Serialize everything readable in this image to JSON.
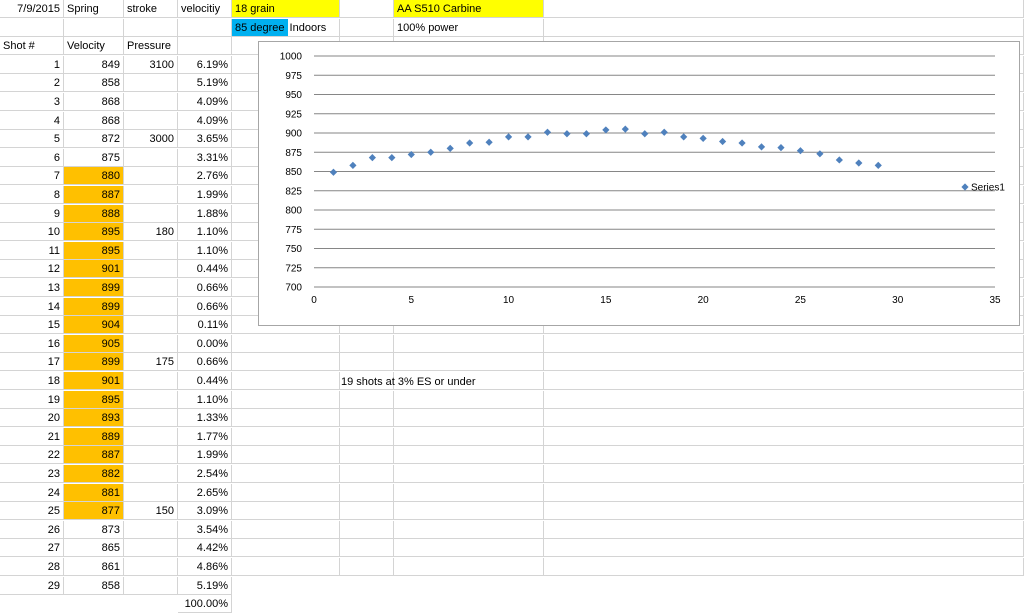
{
  "header": {
    "date": "7/9/2015",
    "spring": "Spring",
    "stroke": "stroke",
    "velocity": "velocitiy",
    "grain": "18 grain",
    "rifle": "AA S510 Carbine",
    "temperature": "85 degree",
    "location": "Indoors",
    "power": "100% power"
  },
  "columns": {
    "shot": "Shot #",
    "velocity": "Velocity",
    "pressure": "Pressure"
  },
  "rows": [
    {
      "shot": "1",
      "velocity": "849",
      "pressure": "3100",
      "pct": "6.19%"
    },
    {
      "shot": "2",
      "velocity": "858",
      "pressure": "",
      "pct": "5.19%"
    },
    {
      "shot": "3",
      "velocity": "868",
      "pressure": "",
      "pct": "4.09%"
    },
    {
      "shot": "4",
      "velocity": "868",
      "pressure": "",
      "pct": "4.09%"
    },
    {
      "shot": "5",
      "velocity": "872",
      "pressure": "3000",
      "pct": "3.65%"
    },
    {
      "shot": "6",
      "velocity": "875",
      "pressure": "",
      "pct": "3.31%"
    },
    {
      "shot": "7",
      "velocity": "880",
      "pressure": "",
      "pct": "2.76%"
    },
    {
      "shot": "8",
      "velocity": "887",
      "pressure": "",
      "pct": "1.99%"
    },
    {
      "shot": "9",
      "velocity": "888",
      "pressure": "",
      "pct": "1.88%"
    },
    {
      "shot": "10",
      "velocity": "895",
      "pressure": "180",
      "pct": "1.10%"
    },
    {
      "shot": "11",
      "velocity": "895",
      "pressure": "",
      "pct": "1.10%"
    },
    {
      "shot": "12",
      "velocity": "901",
      "pressure": "",
      "pct": "0.44%"
    },
    {
      "shot": "13",
      "velocity": "899",
      "pressure": "",
      "pct": "0.66%"
    },
    {
      "shot": "14",
      "velocity": "899",
      "pressure": "",
      "pct": "0.66%"
    },
    {
      "shot": "15",
      "velocity": "904",
      "pressure": "",
      "pct": "0.11%"
    },
    {
      "shot": "16",
      "velocity": "905",
      "pressure": "",
      "pct": "0.00%"
    },
    {
      "shot": "17",
      "velocity": "899",
      "pressure": "175",
      "pct": "0.66%"
    },
    {
      "shot": "18",
      "velocity": "901",
      "pressure": "",
      "pct": "0.44%"
    },
    {
      "shot": "19",
      "velocity": "895",
      "pressure": "",
      "pct": "1.10%"
    },
    {
      "shot": "20",
      "velocity": "893",
      "pressure": "",
      "pct": "1.33%"
    },
    {
      "shot": "21",
      "velocity": "889",
      "pressure": "",
      "pct": "1.77%"
    },
    {
      "shot": "22",
      "velocity": "887",
      "pressure": "",
      "pct": "1.99%"
    },
    {
      "shot": "23",
      "velocity": "882",
      "pressure": "",
      "pct": "2.54%"
    },
    {
      "shot": "24",
      "velocity": "881",
      "pressure": "",
      "pct": "2.65%"
    },
    {
      "shot": "25",
      "velocity": "877",
      "pressure": "150",
      "pct": "3.09%"
    },
    {
      "shot": "26",
      "velocity": "873",
      "pressure": "",
      "pct": "3.54%"
    },
    {
      "shot": "27",
      "velocity": "865",
      "pressure": "",
      "pct": "4.42%"
    },
    {
      "shot": "28",
      "velocity": "861",
      "pressure": "",
      "pct": "4.86%"
    },
    {
      "shot": "29",
      "velocity": "858",
      "pressure": "",
      "pct": "5.19%"
    }
  ],
  "total_pct": "100.00%",
  "note": "19 shots at 3% ES or under",
  "colors": {
    "highlight": "#ffc000",
    "yellow": "#ffff00",
    "blue": "#00b0f0",
    "marker": "#4f81bd"
  },
  "chart_data": {
    "type": "scatter",
    "series": [
      {
        "name": "Series1",
        "x": [
          1,
          2,
          3,
          4,
          5,
          6,
          7,
          8,
          9,
          10,
          11,
          12,
          13,
          14,
          15,
          16,
          17,
          18,
          19,
          20,
          21,
          22,
          23,
          24,
          25,
          26,
          27,
          28,
          29
        ],
        "y": [
          849,
          858,
          868,
          868,
          872,
          875,
          880,
          887,
          888,
          895,
          895,
          901,
          899,
          899,
          904,
          905,
          899,
          901,
          895,
          893,
          889,
          887,
          882,
          881,
          877,
          873,
          865,
          861,
          858
        ]
      }
    ],
    "xlim": [
      0,
      35
    ],
    "ylim": [
      700,
      1000
    ],
    "xticks": [
      0,
      5,
      10,
      15,
      20,
      25,
      30,
      35
    ],
    "yticks": [
      700,
      725,
      750,
      775,
      800,
      825,
      850,
      875,
      900,
      925,
      950,
      975,
      1000
    ],
    "grid": "horizontal",
    "legend": "right",
    "marker": "diamond"
  }
}
